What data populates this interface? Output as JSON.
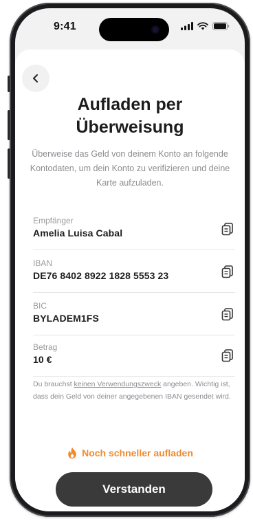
{
  "status_bar": {
    "time": "9:41"
  },
  "header": {
    "back_icon": "chevron-left-icon"
  },
  "main": {
    "title_line1": "Aufladen per",
    "title_line2": "Überweisung",
    "subtitle": "Überweise das Geld von deinem Konto an folgende Kontodaten, um dein Konto zu verifizieren und deine Karte aufzuladen.",
    "fields": [
      {
        "label": "Empfänger",
        "value": "Amelia Luisa Cabal",
        "icon": "copy-icon"
      },
      {
        "label": "IBAN",
        "value": "DE76 8402 8922 1828 5553 23",
        "icon": "copy-icon"
      },
      {
        "label": "BIC",
        "value": "BYLADEM1FS",
        "icon": "copy-icon"
      },
      {
        "label": "Betrag",
        "value": "10 €",
        "icon": "copy-icon"
      }
    ],
    "note": {
      "prefix": "Du brauchst ",
      "link": "keinen Verwendungszweck",
      "suffix": " angeben. Wichtig ist, dass dein Geld von deiner angegebenen IBAN gesendet wird."
    }
  },
  "footer": {
    "fast_link_icon": "flame-icon",
    "fast_link_label": "Noch schneller aufladen",
    "primary_button_label": "Verstanden"
  },
  "colors": {
    "accent": "#f08a2f",
    "button_bg": "#3a3a3a",
    "muted_text": "#8d8d92"
  }
}
